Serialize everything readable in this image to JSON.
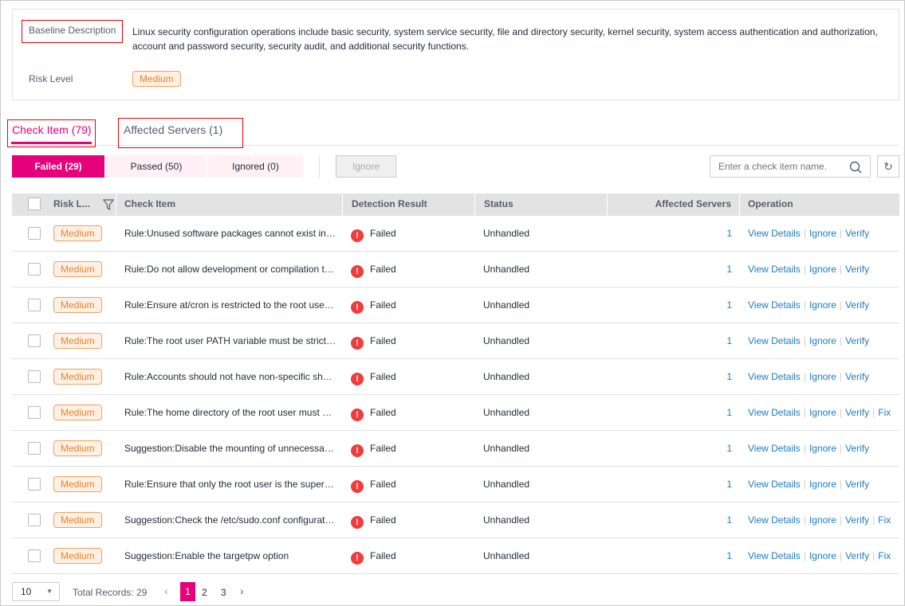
{
  "baseline": {
    "desc_label": "Baseline Description",
    "desc": "Linux security configuration operations include basic security, system service security, file and directory security, kernel security, system access authentication and authorization,",
    "desc2": "account and password security, security audit, and additional security functions.",
    "risk_label": "Risk Level",
    "risk": "Medium"
  },
  "tabs": [
    {
      "label": "Check Item (79)",
      "active": true
    },
    {
      "label": "Affected Servers (1)"
    }
  ],
  "filters": [
    {
      "label": "Failed (29)",
      "active": true
    },
    {
      "label": "Passed (50)"
    },
    {
      "label": "Ignored (0)"
    }
  ],
  "ignore_button": "Ignore",
  "search": {
    "placeholder": "Enter a check item name."
  },
  "colors": {
    "accent": "#e6007a",
    "link": "#1e7ac6",
    "error": "#f23b3b",
    "badge": "#e8832a"
  },
  "columns": [
    "Risk L...",
    "Check Item",
    "Detection Result",
    "Status",
    "Affected Servers",
    "Operation"
  ],
  "rows": [
    {
      "risk": "Medium",
      "item": "Rule:Unused software packages cannot exist in the system",
      "result": "Failed",
      "status": "Unhandled",
      "servers": "1",
      "ops": [
        "View Details",
        "Ignore",
        "Verify"
      ]
    },
    {
      "risk": "Medium",
      "item": "Rule:Do not allow development or compilation tools",
      "result": "Failed",
      "status": "Unhandled",
      "servers": "1",
      "ops": [
        "View Details",
        "Ignore",
        "Verify"
      ]
    },
    {
      "risk": "Medium",
      "item": "Rule:Ensure at/cron is restricted to the root user only",
      "result": "Failed",
      "status": "Unhandled",
      "servers": "1",
      "ops": [
        "View Details",
        "Ignore",
        "Verify"
      ]
    },
    {
      "risk": "Medium",
      "item": "Rule:The root user PATH variable must be strictly configured",
      "result": "Failed",
      "status": "Unhandled",
      "servers": "1",
      "ops": [
        "View Details",
        "Ignore",
        "Verify"
      ]
    },
    {
      "risk": "Medium",
      "item": "Rule:Accounts should not have non-specific shells",
      "result": "Failed",
      "status": "Unhandled",
      "servers": "1",
      "ops": [
        "View Details",
        "Ignore",
        "Verify"
      ]
    },
    {
      "risk": "Medium",
      "item": "Rule:The home directory of the root user must be secured",
      "result": "Failed",
      "status": "Unhandled",
      "servers": "1",
      "ops": [
        "View Details",
        "Ignore",
        "Verify",
        "Fix"
      ]
    },
    {
      "risk": "Medium",
      "item": "Suggestion:Disable the mounting of unnecessary file systems",
      "result": "Failed",
      "status": "Unhandled",
      "servers": "1",
      "ops": [
        "View Details",
        "Ignore",
        "Verify"
      ]
    },
    {
      "risk": "Medium",
      "item": "Rule:Ensure that only the root user is the super user",
      "result": "Failed",
      "status": "Unhandled",
      "servers": "1",
      "ops": [
        "View Details",
        "Ignore",
        "Verify"
      ]
    },
    {
      "risk": "Medium",
      "item": "Suggestion:Check the /etc/sudo.conf configuration file",
      "result": "Failed",
      "status": "Unhandled",
      "servers": "1",
      "ops": [
        "View Details",
        "Ignore",
        "Verify",
        "Fix"
      ]
    },
    {
      "risk": "Medium",
      "item": "Suggestion:Enable the targetpw option",
      "result": "Failed",
      "status": "Unhandled",
      "servers": "1",
      "ops": [
        "View Details",
        "Ignore",
        "Verify",
        "Fix"
      ]
    }
  ],
  "pagination": {
    "page_size": "10",
    "total": "Total Records: 29",
    "pages": [
      "1",
      "2",
      "3"
    ],
    "current": "1"
  }
}
